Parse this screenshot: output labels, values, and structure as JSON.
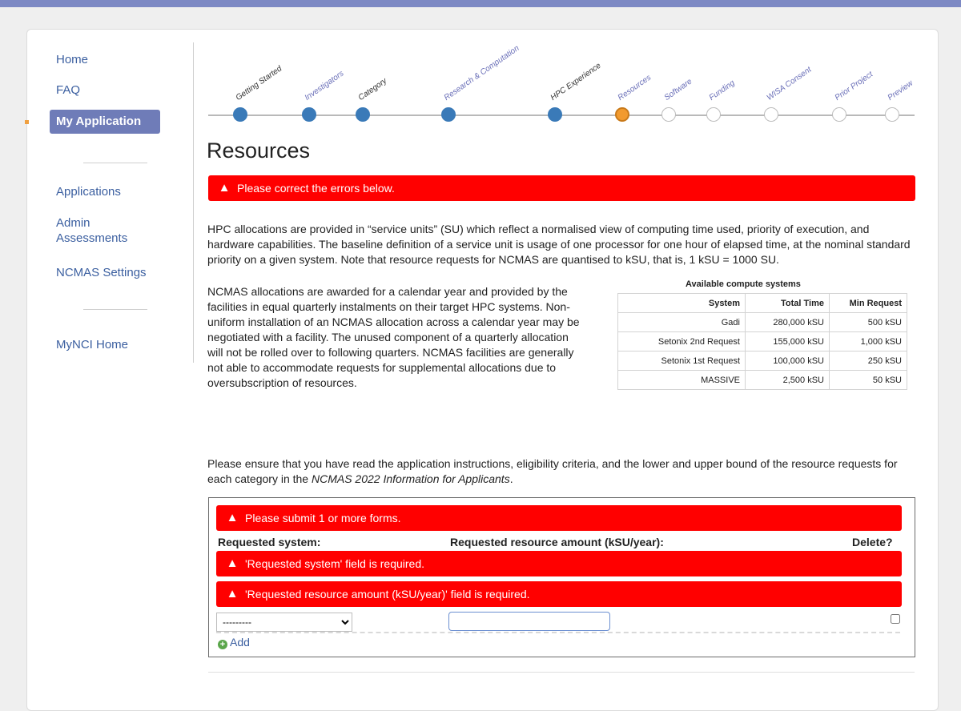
{
  "sidebar": {
    "home": "Home",
    "faq": "FAQ",
    "my_application": "My Application",
    "applications": "Applications",
    "admin_assessments_1": "Admin",
    "admin_assessments_2": "Assessments",
    "ncmas_settings": "NCMAS Settings",
    "mynci_home": "MyNCI Home"
  },
  "wizard": {
    "steps": [
      {
        "label": "Getting Started",
        "state": "done"
      },
      {
        "label": "Investigators",
        "state": "done"
      },
      {
        "label": "Category",
        "state": "done"
      },
      {
        "label": "Research & Computation",
        "state": "done"
      },
      {
        "label": "HPC Experience",
        "state": "done"
      },
      {
        "label": "Resources",
        "state": "current"
      },
      {
        "label": "Software",
        "state": "todo"
      },
      {
        "label": "Funding",
        "state": "todo"
      },
      {
        "label": "WISA Consent",
        "state": "todo"
      },
      {
        "label": "Prior Project",
        "state": "todo"
      },
      {
        "label": "Preview",
        "state": "todo"
      }
    ]
  },
  "page": {
    "title": "Resources",
    "error_top": "Please correct the errors below.",
    "intro": "HPC allocations are provided in “service units” (SU) which reflect a normalised view of computing time used, priority of execution, and hardware capabilities. The baseline definition of a service unit is usage of one processor for one hour of elapsed time, at the nominal standard priority on a given system. Note that resource requests for NCMAS are quantised to kSU, that is, 1 kSU = 1000 SU.",
    "allocations": "NCMAS allocations are awarded for a calendar year and provided by the facilities in equal quarterly instalments on their target HPC systems. Non-uniform installation of an NCMAS allocation across a calendar year may be negotiated with a facility. The unused component of a quarterly allocation will not be rolled over to following quarters. NCMAS facilities are generally not able to accommodate requests for supplemental allocations due to oversubscription of resources.",
    "instructions_prefix": "Please ensure that you have read the application instructions, eligibility criteria, and the lower and upper bound of the resource requests for each category in the ",
    "instructions_doc": "NCMAS 2022 Information for Applicants",
    "instructions_suffix": "."
  },
  "systems_table": {
    "title": "Available compute systems",
    "headers": [
      "System",
      "Total Time",
      "Min Request"
    ],
    "rows": [
      [
        "Gadi",
        "280,000 kSU",
        "500 kSU"
      ],
      [
        "Setonix 2nd Request",
        "155,000 kSU",
        "1,000 kSU"
      ],
      [
        "Setonix 1st Request",
        "100,000 kSU",
        "250 kSU"
      ],
      [
        "MASSIVE",
        "2,500 kSU",
        "50 kSU"
      ]
    ]
  },
  "form": {
    "error_forms": "Please submit 1 or more forms.",
    "col_system": "Requested system:",
    "col_amount": "Requested resource amount (kSU/year):",
    "col_delete": "Delete?",
    "error_system": "'Requested system' field is required.",
    "error_amount": "'Requested resource amount (kSU/year)' field is required.",
    "system_selected": "---------",
    "amount_value": "",
    "add_label": "Add"
  },
  "colors": {
    "error": "#ff0000",
    "accent": "#6f7cb8",
    "link": "#3b5fa0",
    "step_done": "#3a7ab8",
    "step_current": "#f29a2e"
  }
}
